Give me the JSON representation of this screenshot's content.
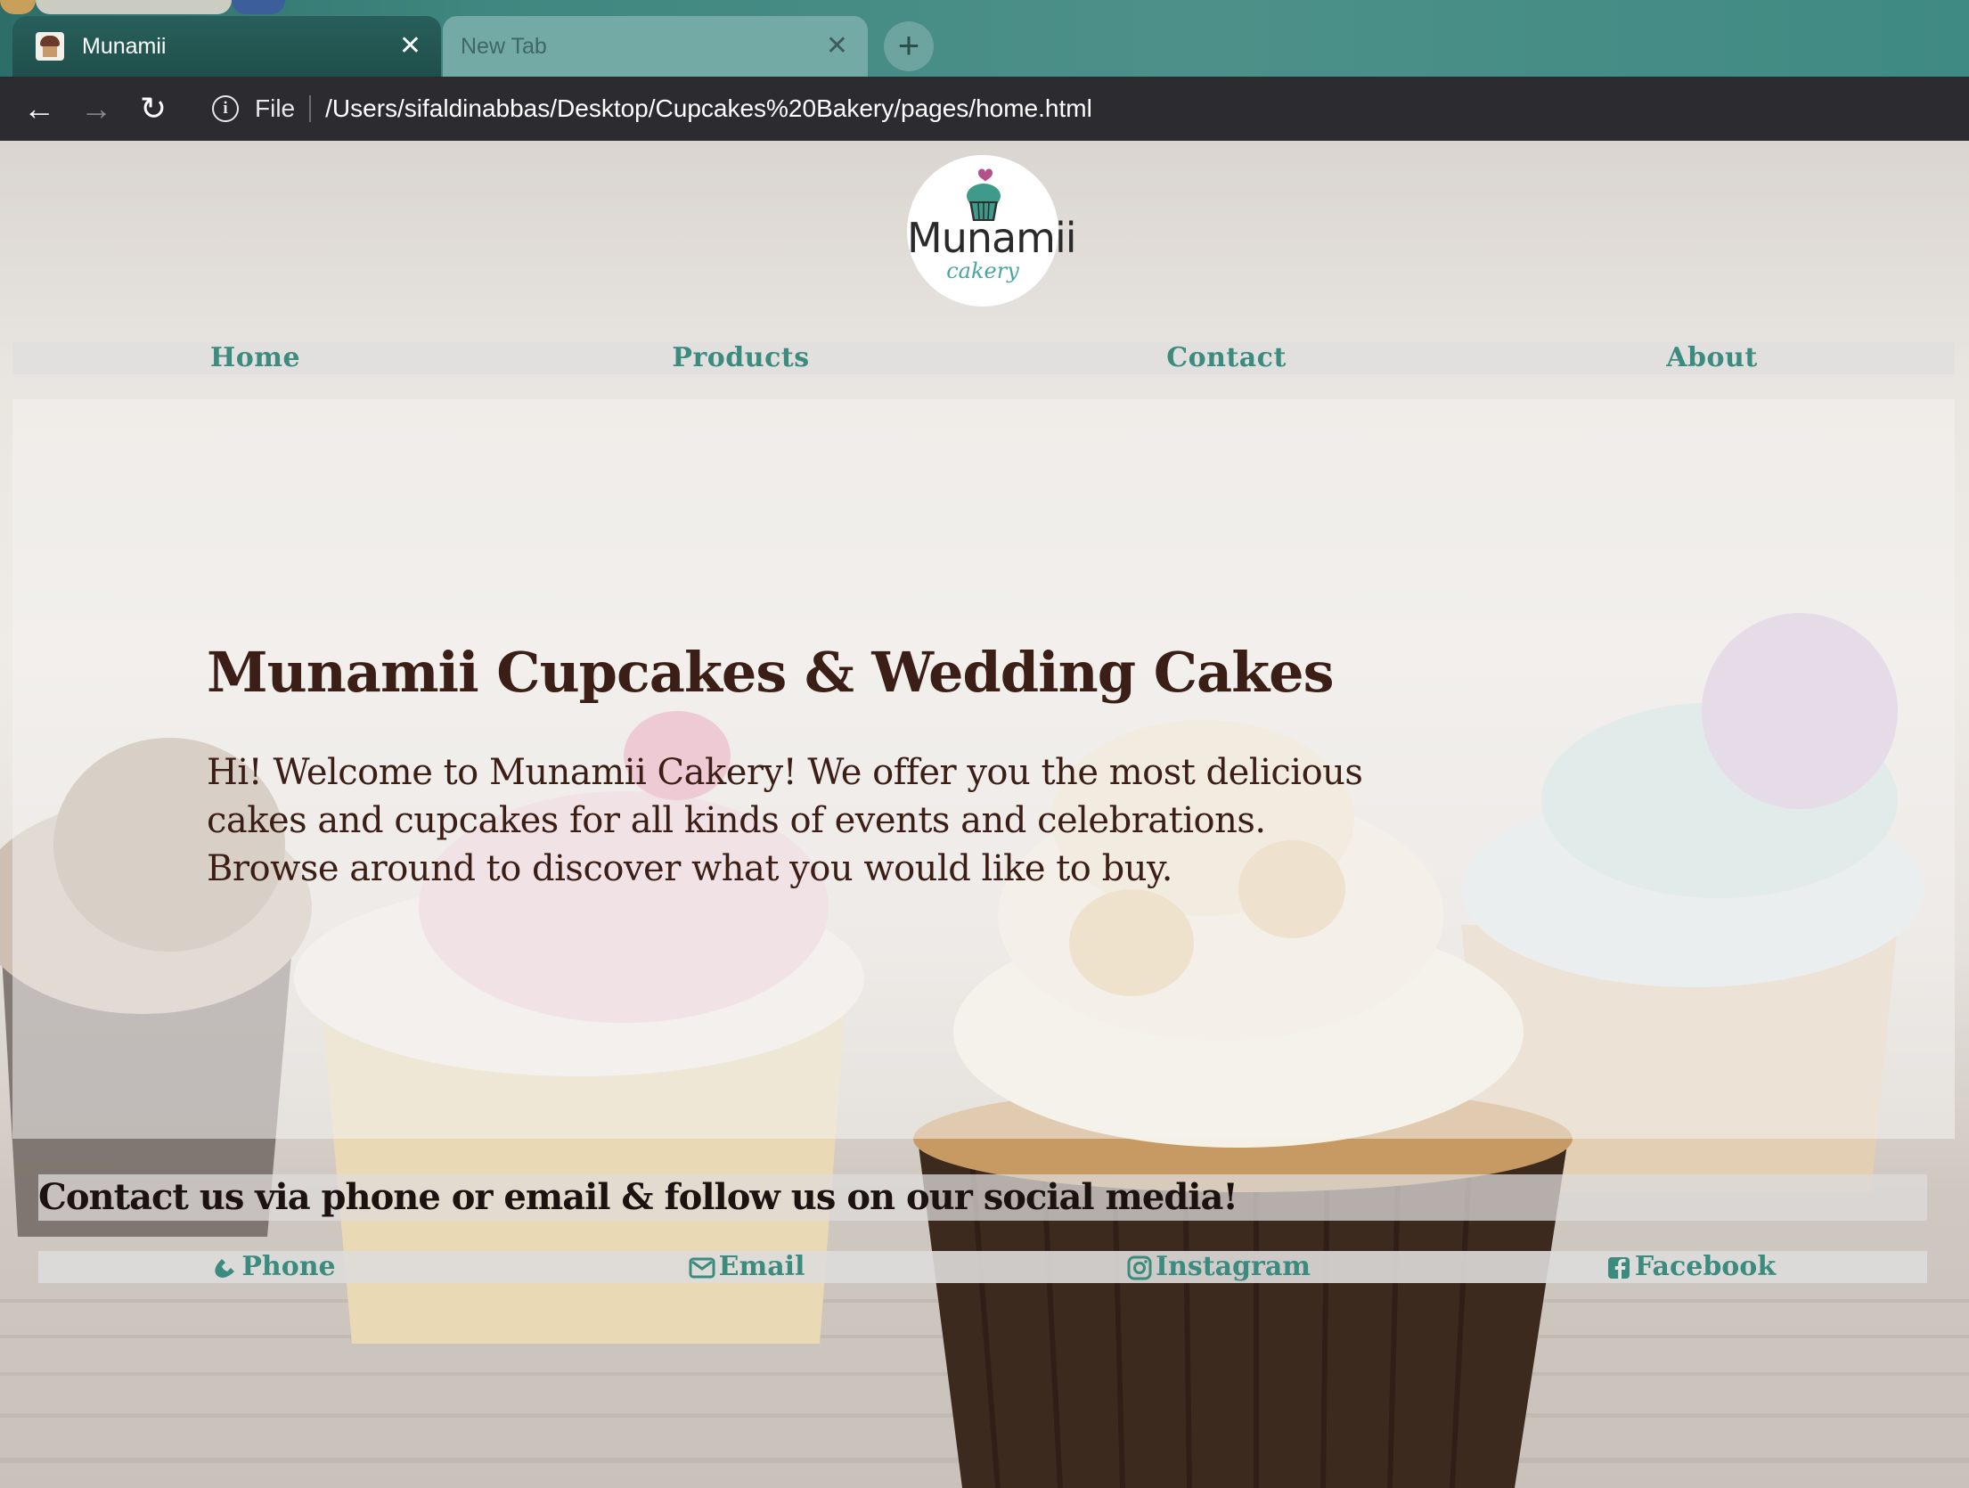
{
  "browser": {
    "tabs": [
      {
        "title": "Munamii",
        "active": true
      },
      {
        "title": "New Tab",
        "active": false
      }
    ],
    "address": {
      "scheme_label": "File",
      "url": "/Users/sifaldinabbas/Desktop/Cupcakes%20Bakery/pages/home.html"
    }
  },
  "page": {
    "logo": {
      "name": "Munamii",
      "sub": "cakery"
    },
    "nav": [
      {
        "label": "Home"
      },
      {
        "label": "Products"
      },
      {
        "label": "Contact"
      },
      {
        "label": "About"
      }
    ],
    "hero": {
      "title": "Munamii Cupcakes & Wedding Cakes",
      "body": "Hi! Welcome to Munamii Cakery! We offer you the most delicious cakes and cupcakes for all kinds of events and celebrations. Browse around to discover what you would like to buy."
    },
    "contact": {
      "heading": "Contact us via phone or email & follow us on our social media!",
      "links": [
        {
          "label": "Phone",
          "icon": "phone-icon"
        },
        {
          "label": "Email",
          "icon": "envelope-icon"
        },
        {
          "label": "Instagram",
          "icon": "instagram-icon"
        },
        {
          "label": "Facebook",
          "icon": "facebook-icon"
        }
      ]
    }
  },
  "colors": {
    "tabstrip": "#3f8780",
    "toolbar": "#2b2b30",
    "nav_link": "#3b8b7e",
    "heading_text": "#3b1e16"
  }
}
